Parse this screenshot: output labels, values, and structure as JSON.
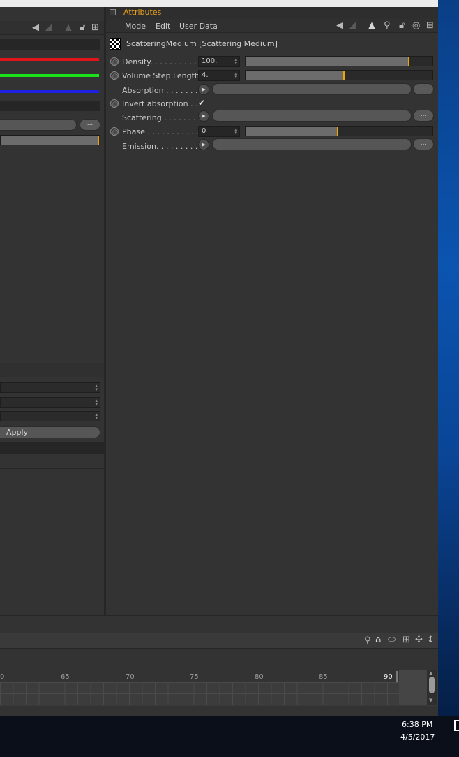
{
  "attributes": {
    "panel_title": "Attributes",
    "menu": [
      "Mode",
      "Edit",
      "User Data"
    ],
    "object_title": "ScatteringMedium [Scattering Medium]",
    "params": {
      "density": {
        "label": "Density. . . . . . . . . . .",
        "value": "100.",
        "slider_fraction": 0.87
      },
      "volume_step": {
        "label": "Volume Step Length",
        "value": "4.",
        "slider_fraction": 0.5
      },
      "absorption": {
        "label": "Absorption . . . . . . .",
        "button": "..."
      },
      "invert_absorption": {
        "label": "Invert absorption . .",
        "checked_glyph": "✔"
      },
      "scattering": {
        "label": "Scattering . . . . . . . .",
        "button": "..."
      },
      "phase": {
        "label": "Phase . . . . . . . . . . . .",
        "value": "0",
        "slider_fraction": 0.5
      },
      "emission": {
        "label": "Emission. . . . . . . . . .",
        "button": "..."
      }
    }
  },
  "left_panel": {
    "browse_button": "...",
    "apply_button": "Apply",
    "color_lines": [
      "#e0141b",
      "#1de01d",
      "#1e22e0"
    ]
  },
  "timeline": {
    "ticks": [
      "0",
      "65",
      "70",
      "75",
      "80",
      "85",
      "90"
    ]
  },
  "taskbar": {
    "time": "6:38 PM",
    "date": "4/5/2017"
  }
}
